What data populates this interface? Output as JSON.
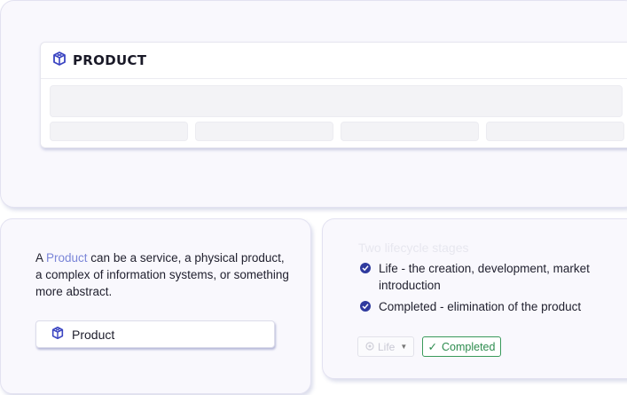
{
  "product_panel": {
    "title": "PRODUCT"
  },
  "description": {
    "prefix": "A ",
    "link": "Product",
    "rest": " can be a service, a physical product, a complex of information systems, or something more abstract."
  },
  "product_chip": {
    "label": "Product"
  },
  "lifecycle": {
    "title": "Two lifecycle stages",
    "stages": [
      "Life - the creation, development, market introduction",
      "Completed - elimination of the product"
    ]
  },
  "life_select": {
    "value": "Life"
  },
  "completed_badge": {
    "label": "Completed",
    "color": "#2d8c4e"
  },
  "colors": {
    "accent": "#4a54c8",
    "link": "#7b86d8"
  }
}
